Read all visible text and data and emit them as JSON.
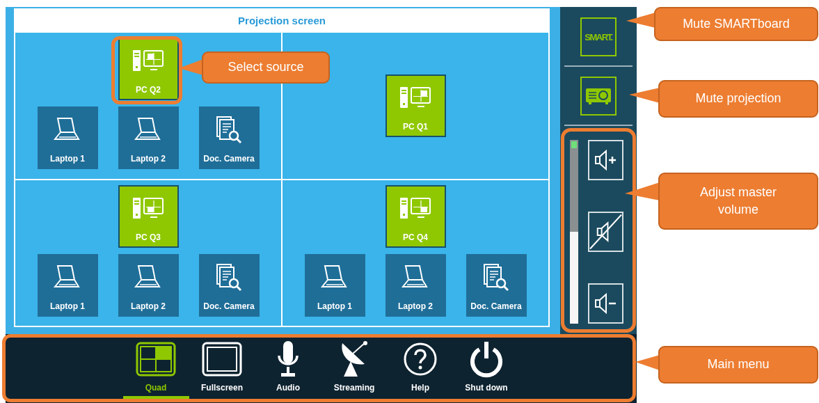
{
  "projection": {
    "title": "Projection screen",
    "quadrants": [
      {
        "sources": [
          {
            "kind": "pc",
            "label": "PC Q2",
            "selected": true
          },
          {
            "kind": "laptop",
            "label": "Laptop 1",
            "selected": false
          },
          {
            "kind": "laptop",
            "label": "Laptop 2",
            "selected": false
          },
          {
            "kind": "camera",
            "label": "Doc. Camera",
            "selected": false
          }
        ]
      },
      {
        "sources": [
          {
            "kind": "pc",
            "label": "PC Q1",
            "selected": true
          }
        ]
      },
      {
        "sources": [
          {
            "kind": "pc",
            "label": "PC Q3",
            "selected": true
          },
          {
            "kind": "laptop",
            "label": "Laptop 1",
            "selected": false
          },
          {
            "kind": "laptop",
            "label": "Laptop 2",
            "selected": false
          },
          {
            "kind": "camera",
            "label": "Doc. Camera",
            "selected": false
          }
        ]
      },
      {
        "sources": [
          {
            "kind": "pc",
            "label": "PC Q4",
            "selected": true
          },
          {
            "kind": "laptop",
            "label": "Laptop 1",
            "selected": false
          },
          {
            "kind": "laptop",
            "label": "Laptop 2",
            "selected": false
          },
          {
            "kind": "camera",
            "label": "Doc. Camera",
            "selected": false
          }
        ]
      }
    ]
  },
  "sidebar": {
    "smart_button": {
      "logo": "SMART."
    },
    "volume": {
      "level": 0.5
    }
  },
  "main_menu": [
    {
      "kind": "quad",
      "label": "Quad",
      "selected": true
    },
    {
      "kind": "fullscreen",
      "label": "Fullscreen",
      "selected": false
    },
    {
      "kind": "audio",
      "label": "Audio",
      "selected": false
    },
    {
      "kind": "streaming",
      "label": "Streaming",
      "selected": false
    },
    {
      "kind": "help",
      "label": "Help",
      "selected": false
    },
    {
      "kind": "shutdown",
      "label": "Shut down",
      "selected": false
    }
  ],
  "annotations": [
    {
      "text": "Mute SMARTboard"
    },
    {
      "text": "Select source"
    },
    {
      "text": "Mute projection"
    },
    {
      "text": "Adjust master volume"
    },
    {
      "text": "Main menu"
    }
  ]
}
